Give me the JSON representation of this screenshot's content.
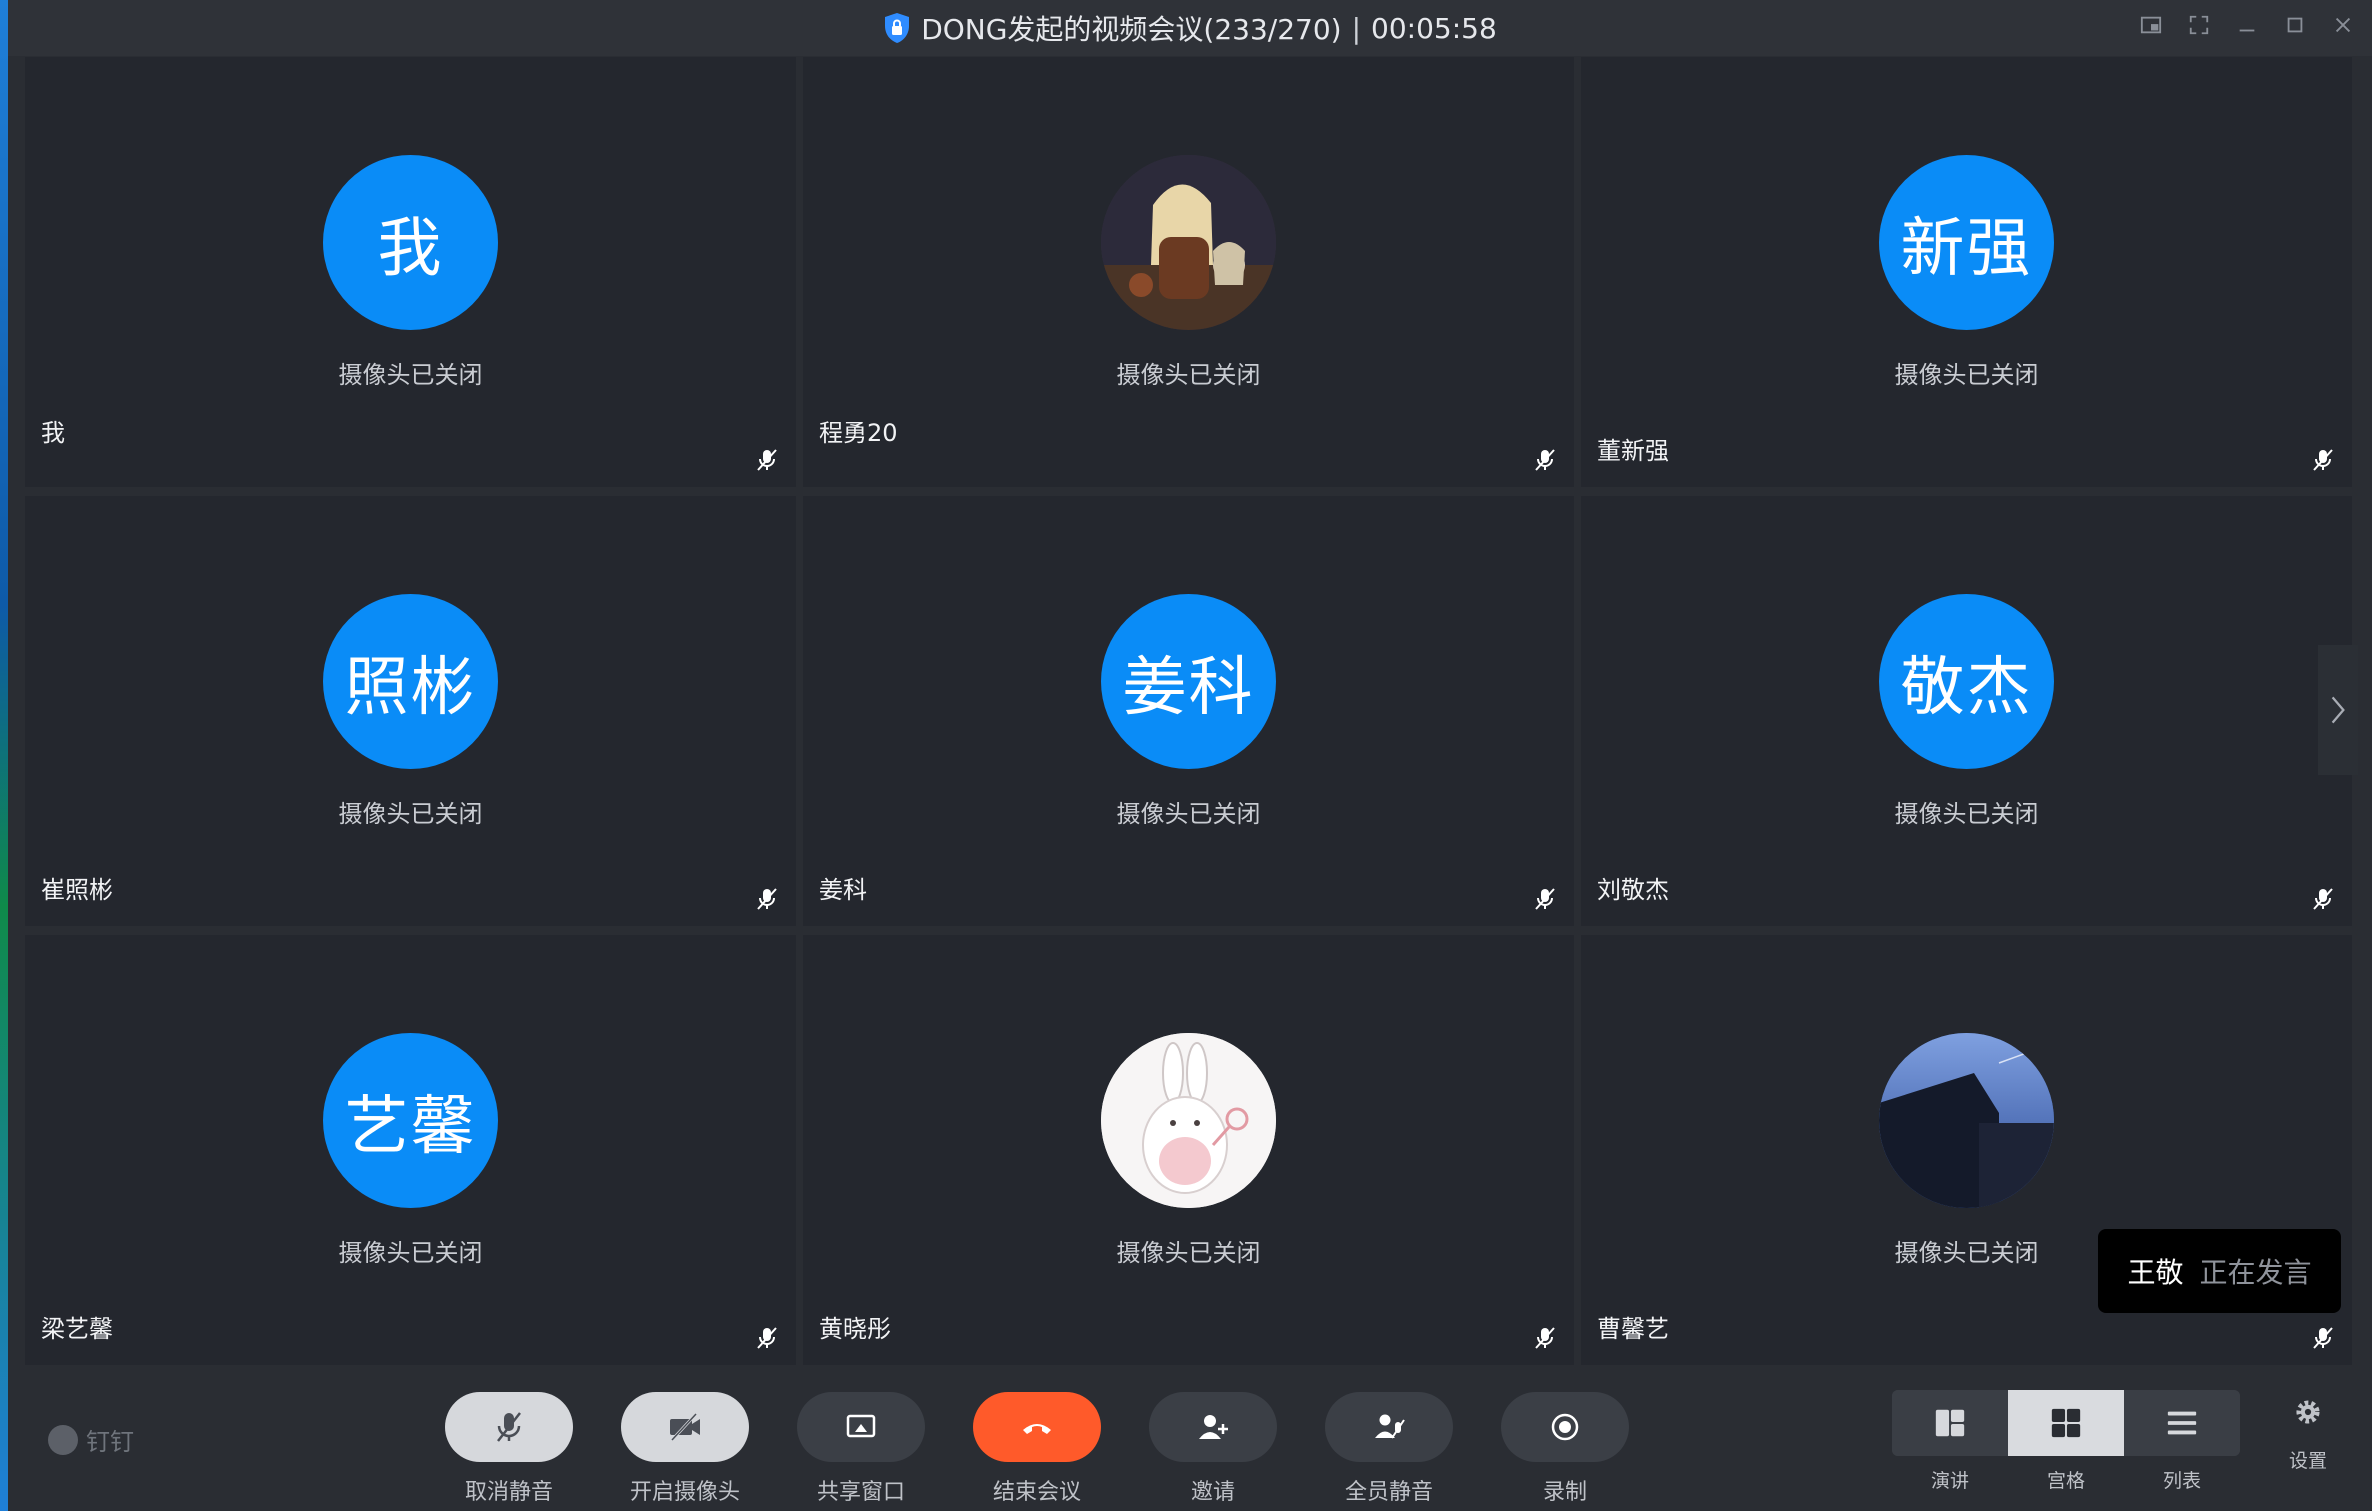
{
  "window": {
    "title": "DONG发起的视频会议(233/270)",
    "separator": "|",
    "elapsed": "00:05:58"
  },
  "tiles": [
    {
      "name": "我",
      "avatar_text": "我",
      "status": "摄像头已关闭",
      "avatar_kind": "text"
    },
    {
      "name": "程勇20",
      "avatar_text": "",
      "status": "摄像头已关闭",
      "avatar_kind": "photo-anime"
    },
    {
      "name": "董新强",
      "avatar_text": "新强",
      "status": "摄像头已关闭",
      "avatar_kind": "text"
    },
    {
      "name": "崔照彬",
      "avatar_text": "照彬",
      "status": "摄像头已关闭",
      "avatar_kind": "text"
    },
    {
      "name": "姜科",
      "avatar_text": "姜科",
      "status": "摄像头已关闭",
      "avatar_kind": "text"
    },
    {
      "name": "刘敬杰",
      "avatar_text": "敬杰",
      "status": "摄像头已关闭",
      "avatar_kind": "text"
    },
    {
      "name": "梁艺馨",
      "avatar_text": "艺馨",
      "status": "摄像头已关闭",
      "avatar_kind": "text"
    },
    {
      "name": "黄晓彤",
      "avatar_text": "",
      "status": "摄像头已关闭",
      "avatar_kind": "photo-bunny"
    },
    {
      "name": "曹馨艺",
      "avatar_text": "",
      "status": "摄像头已关闭",
      "avatar_kind": "photo-building"
    }
  ],
  "speaking": {
    "who": "王敬",
    "what": "正在发言"
  },
  "toolbar": {
    "brand": "钉钉",
    "buttons": [
      {
        "label": "取消静音",
        "icon": "mic-off-icon"
      },
      {
        "label": "开启摄像头",
        "icon": "camera-off-icon"
      },
      {
        "label": "共享窗口",
        "icon": "share-window-icon"
      },
      {
        "label": "结束会议",
        "icon": "hang-up-icon"
      },
      {
        "label": "邀请",
        "icon": "invite-user-icon"
      },
      {
        "label": "全员静音",
        "icon": "mute-all-icon"
      },
      {
        "label": "录制",
        "icon": "record-icon"
      }
    ],
    "views": [
      {
        "label": "演讲",
        "icon": "speaker-view-icon",
        "active": false
      },
      {
        "label": "宫格",
        "icon": "grid-view-icon",
        "active": true
      },
      {
        "label": "列表",
        "icon": "list-view-icon",
        "active": false
      }
    ],
    "settings_label": "设置"
  },
  "colors": {
    "avatar_blue": "#0a8cf7",
    "end_call": "#ff5a2a",
    "tile_bg": "#24272e"
  }
}
